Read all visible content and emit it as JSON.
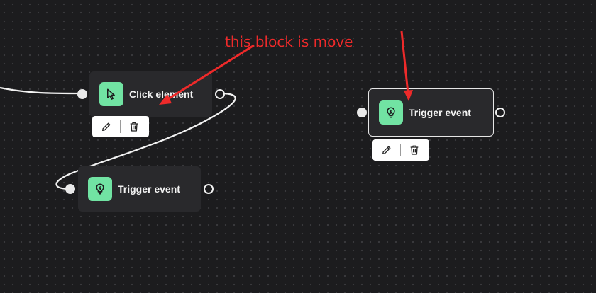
{
  "canvas": {
    "background": "#1c1c1e",
    "dot_color": "#3a3a3d"
  },
  "nodes": [
    {
      "id": "click-element-node",
      "label": "Click element",
      "icon": "cursor-pointer-icon",
      "icon_color": "#71e3a3",
      "selected": false
    },
    {
      "id": "trigger-event-node-bottom",
      "label": "Trigger event",
      "icon": "lightbulb-icon",
      "icon_color": "#71e3a3",
      "selected": false
    },
    {
      "id": "trigger-event-node-moved",
      "label": "Trigger event",
      "icon": "lightbulb-icon",
      "icon_color": "#71e3a3",
      "selected": true
    }
  ],
  "toolbar": {
    "edit_icon": "pencil-icon",
    "delete_icon": "trash-icon"
  },
  "annotation": {
    "text": "this block is move",
    "color": "#ee2a2a"
  }
}
